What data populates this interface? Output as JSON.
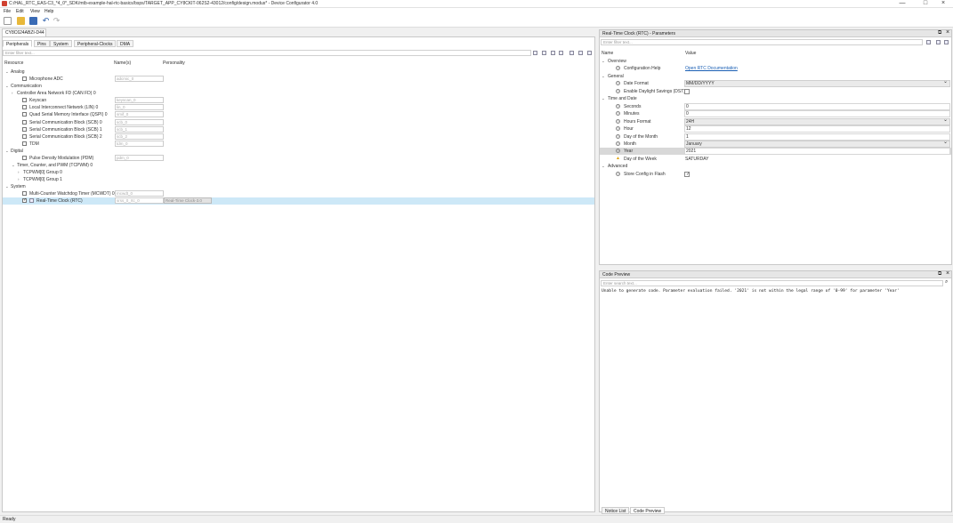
{
  "window": {
    "title": "C:/HAL_RTC_EAS-C3_*4_0*_SDK/mtb-example-hal-rtc-basics/bsps/TARGET_APP_CY8CKIT-062S2-43012/config/design.modus* - Device Configurator 4.0",
    "controls": [
      "—",
      "□",
      "×"
    ]
  },
  "menu": [
    "File",
    "Edit",
    "View",
    "Help"
  ],
  "document_tab": "CY8C624ABZI-D44",
  "left_tabs": [
    "Peripherals",
    "Pins",
    "System",
    "Peripheral-Clocks",
    "DMA"
  ],
  "left_filter_placeholder": "Enter filter text...",
  "columns": {
    "resource": "Resource",
    "name": "Name(s)",
    "personality": "Personality"
  },
  "resources": [
    {
      "indent": 0,
      "arrow": "⌄",
      "label": "Analog"
    },
    {
      "indent": 1,
      "checkbox": false,
      "label": "Microphone ADC",
      "name": "adcmic_0"
    },
    {
      "indent": 0,
      "arrow": "⌄",
      "label": "Communication"
    },
    {
      "indent": 1,
      "arrow": "›",
      "label": "Controller Area Network FD (CAN FD) 0"
    },
    {
      "indent": 1,
      "checkbox": false,
      "label": "Keyscan",
      "name": "keyscan_0"
    },
    {
      "indent": 1,
      "checkbox": false,
      "label": "Local Interconnect Network (LIN) 0",
      "name": "lin_0"
    },
    {
      "indent": 1,
      "checkbox": false,
      "label": "Quad Serial Memory Interface (QSPI) 0",
      "name": "smif_0"
    },
    {
      "indent": 1,
      "checkbox": false,
      "label": "Serial Communication Block (SCB) 0",
      "name": "scb_0"
    },
    {
      "indent": 1,
      "checkbox": false,
      "label": "Serial Communication Block (SCB) 1",
      "name": "scb_1"
    },
    {
      "indent": 1,
      "checkbox": false,
      "label": "Serial Communication Block (SCB) 2",
      "name": "scb_2"
    },
    {
      "indent": 1,
      "checkbox": false,
      "label": "TDM",
      "name": "tdm_0"
    },
    {
      "indent": 0,
      "arrow": "⌄",
      "label": "Digital"
    },
    {
      "indent": 1,
      "checkbox": false,
      "label": "Pulse Density Modulation (PDM)",
      "name": "pdm_0"
    },
    {
      "indent": 1,
      "arrow": "⌄",
      "label": "Timer, Counter, and PWM (TCPWM) 0"
    },
    {
      "indent": 2,
      "arrow": "›",
      "label": "TCPWM[0] Group 0"
    },
    {
      "indent": 2,
      "arrow": "›",
      "label": "TCPWM[0] Group 1"
    },
    {
      "indent": 0,
      "arrow": "⌄",
      "label": "System"
    },
    {
      "indent": 1,
      "checkbox": false,
      "label": "Multi-Counter Watchdog Timer (MCWDT) 0",
      "name": "mcwdt_0"
    },
    {
      "indent": 1,
      "checkbox": true,
      "label": "Real-Time Clock (RTC)",
      "name": "srss_0_rtc_0",
      "personality": "Real-Time Clock-3.0",
      "selected": true
    }
  ],
  "params_panel": {
    "title": "Real-Time Clock (RTC) - Parameters",
    "filter_placeholder": "Enter filter text...",
    "col_name": "Name",
    "col_value": "Value",
    "rows": [
      {
        "type": "group",
        "label": "Overview"
      },
      {
        "type": "param",
        "label": "Configuration Help",
        "value": "Open RTC Documentation",
        "kind": "link"
      },
      {
        "type": "group",
        "label": "General"
      },
      {
        "type": "param",
        "label": "Date Format",
        "value": "MM/DD/YYYY",
        "kind": "dropdown"
      },
      {
        "type": "param",
        "label": "Enable Daylight Savings (DST)",
        "value": "",
        "kind": "checkbox"
      },
      {
        "type": "group",
        "label": "Time and Date"
      },
      {
        "type": "param",
        "label": "Seconds",
        "value": "0",
        "kind": "text"
      },
      {
        "type": "param",
        "label": "Minutes",
        "value": "0",
        "kind": "text"
      },
      {
        "type": "param",
        "label": "Hours Format",
        "value": "24H",
        "kind": "dropdown"
      },
      {
        "type": "param",
        "label": "Hour",
        "value": "12",
        "kind": "text"
      },
      {
        "type": "param",
        "label": "Day of the Month",
        "value": "1",
        "kind": "text"
      },
      {
        "type": "param",
        "label": "Month",
        "value": "January",
        "kind": "dropdown"
      },
      {
        "type": "param",
        "label": "Year",
        "value": "2021",
        "kind": "text",
        "selected": true
      },
      {
        "type": "param",
        "label": "Day of the Week",
        "value": "SATURDAY",
        "kind": "warn"
      },
      {
        "type": "group",
        "label": "Advanced"
      },
      {
        "type": "param",
        "label": "Store Config in Flash",
        "value": "✓",
        "kind": "checkbox-on"
      }
    ]
  },
  "code_panel": {
    "title": "Code Preview",
    "search_placeholder": "Enter search text...",
    "message": "Unable to generate code. Parameter evaluation failed. '2021' is not within the legal range of '0-99' for parameter 'Year'"
  },
  "bottom_tabs": [
    "Notice List",
    "Code Preview"
  ],
  "status": "Ready",
  "colors": {
    "selection": "#cde8f7",
    "link": "#1a5fb4",
    "warning": "#e0a000"
  }
}
